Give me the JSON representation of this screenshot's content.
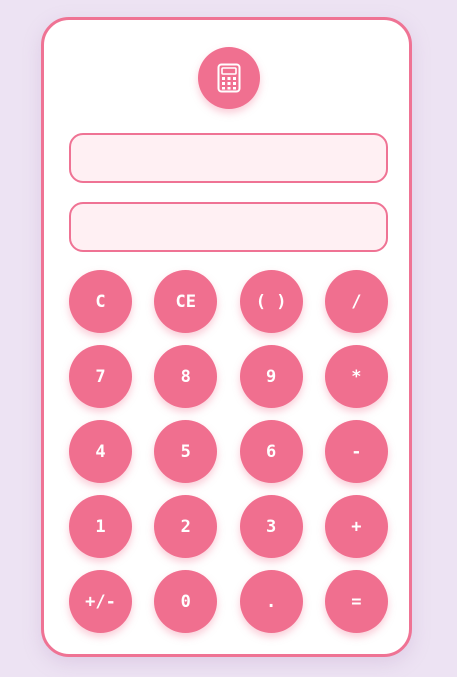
{
  "logo": {
    "icon": "calculator-icon"
  },
  "displays": {
    "expression": "",
    "result": ""
  },
  "keys": [
    {
      "label": "C"
    },
    {
      "label": "CE"
    },
    {
      "label": "( )"
    },
    {
      "label": "/"
    },
    {
      "label": "7"
    },
    {
      "label": "8"
    },
    {
      "label": "9"
    },
    {
      "label": "*"
    },
    {
      "label": "4"
    },
    {
      "label": "5"
    },
    {
      "label": "6"
    },
    {
      "label": "-"
    },
    {
      "label": "1"
    },
    {
      "label": "2"
    },
    {
      "label": "3"
    },
    {
      "label": "+"
    },
    {
      "label": "+/-"
    },
    {
      "label": "0"
    },
    {
      "label": "."
    },
    {
      "label": "="
    }
  ],
  "colors": {
    "accent": "#f06f8f",
    "border": "#ef7394",
    "display_bg": "#fff0f3",
    "page_bg": "#ede3f3"
  }
}
